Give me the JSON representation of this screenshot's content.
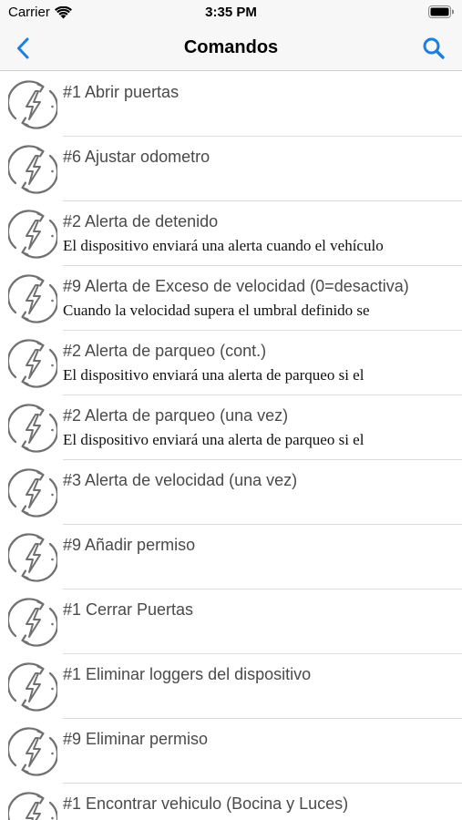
{
  "status_bar": {
    "carrier": "Carrier",
    "time": "3:35 PM"
  },
  "nav": {
    "title": "Comandos",
    "back_icon": "chevron-left-icon",
    "search_icon": "search-icon"
  },
  "colors": {
    "accent": "#1a7fe0",
    "icon_stroke": "#707070",
    "title_text": "#4a4a4a"
  },
  "commands": [
    {
      "title": "#1 Abrir puertas",
      "subtitle": ""
    },
    {
      "title": "#6 Ajustar odometro",
      "subtitle": ""
    },
    {
      "title": "#2 Alerta de detenido",
      "subtitle": "El dispositivo enviará una alerta cuando el vehículo"
    },
    {
      "title": "#9 Alerta de Exceso de velocidad (0=desactiva)",
      "subtitle": "Cuando la velocidad supera el umbral definido se"
    },
    {
      "title": "#2 Alerta de parqueo (cont.)",
      "subtitle": "El dispositivo enviará una alerta de parqueo si el"
    },
    {
      "title": "#2 Alerta de parqueo (una vez)",
      "subtitle": "El dispositivo enviará una alerta de parqueo si el"
    },
    {
      "title": "#3 Alerta de velocidad (una vez)",
      "subtitle": ""
    },
    {
      "title": "#9 Añadir permiso",
      "subtitle": ""
    },
    {
      "title": "#1 Cerrar Puertas",
      "subtitle": ""
    },
    {
      "title": "#1 Eliminar loggers del dispositivo",
      "subtitle": ""
    },
    {
      "title": "#9 Eliminar permiso",
      "subtitle": ""
    },
    {
      "title": "#1 Encontrar vehiculo (Bocina y Luces)",
      "subtitle": ""
    }
  ]
}
